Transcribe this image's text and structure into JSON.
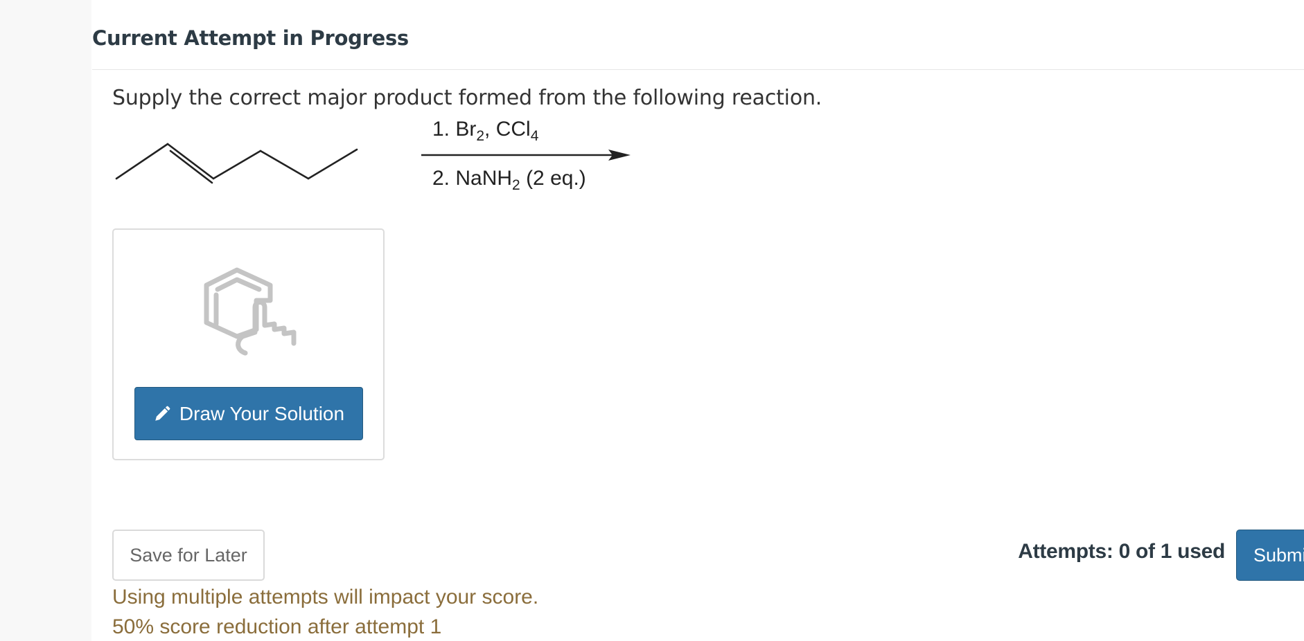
{
  "header": {
    "title": "Current Attempt in Progress"
  },
  "question": {
    "prompt": "Supply the correct major product formed from the following reaction.",
    "reagent_step1": {
      "prefix": "1. Br",
      "sub1": "2",
      "mid": ", CCl",
      "sub2": "4"
    },
    "reagent_step2": {
      "prefix": "2. NaNH",
      "sub1": "2",
      "suffix": " (2 eq.)"
    }
  },
  "drawing": {
    "button_label": "Draw Your Solution",
    "icon": "molecule-hand-icon",
    "button_icon": "pencil-icon"
  },
  "footer": {
    "save_label": "Save for Later",
    "attempts_text": "Attempts: 0 of 1 used",
    "submit_label": "Submit Answer",
    "notice_line1": "Using multiple attempts will impact your score.",
    "notice_line2": "50% score reduction after attempt 1"
  },
  "colors": {
    "primary": "#2f74a9",
    "notice": "#8a6d3b",
    "heading": "#2d3b45"
  }
}
